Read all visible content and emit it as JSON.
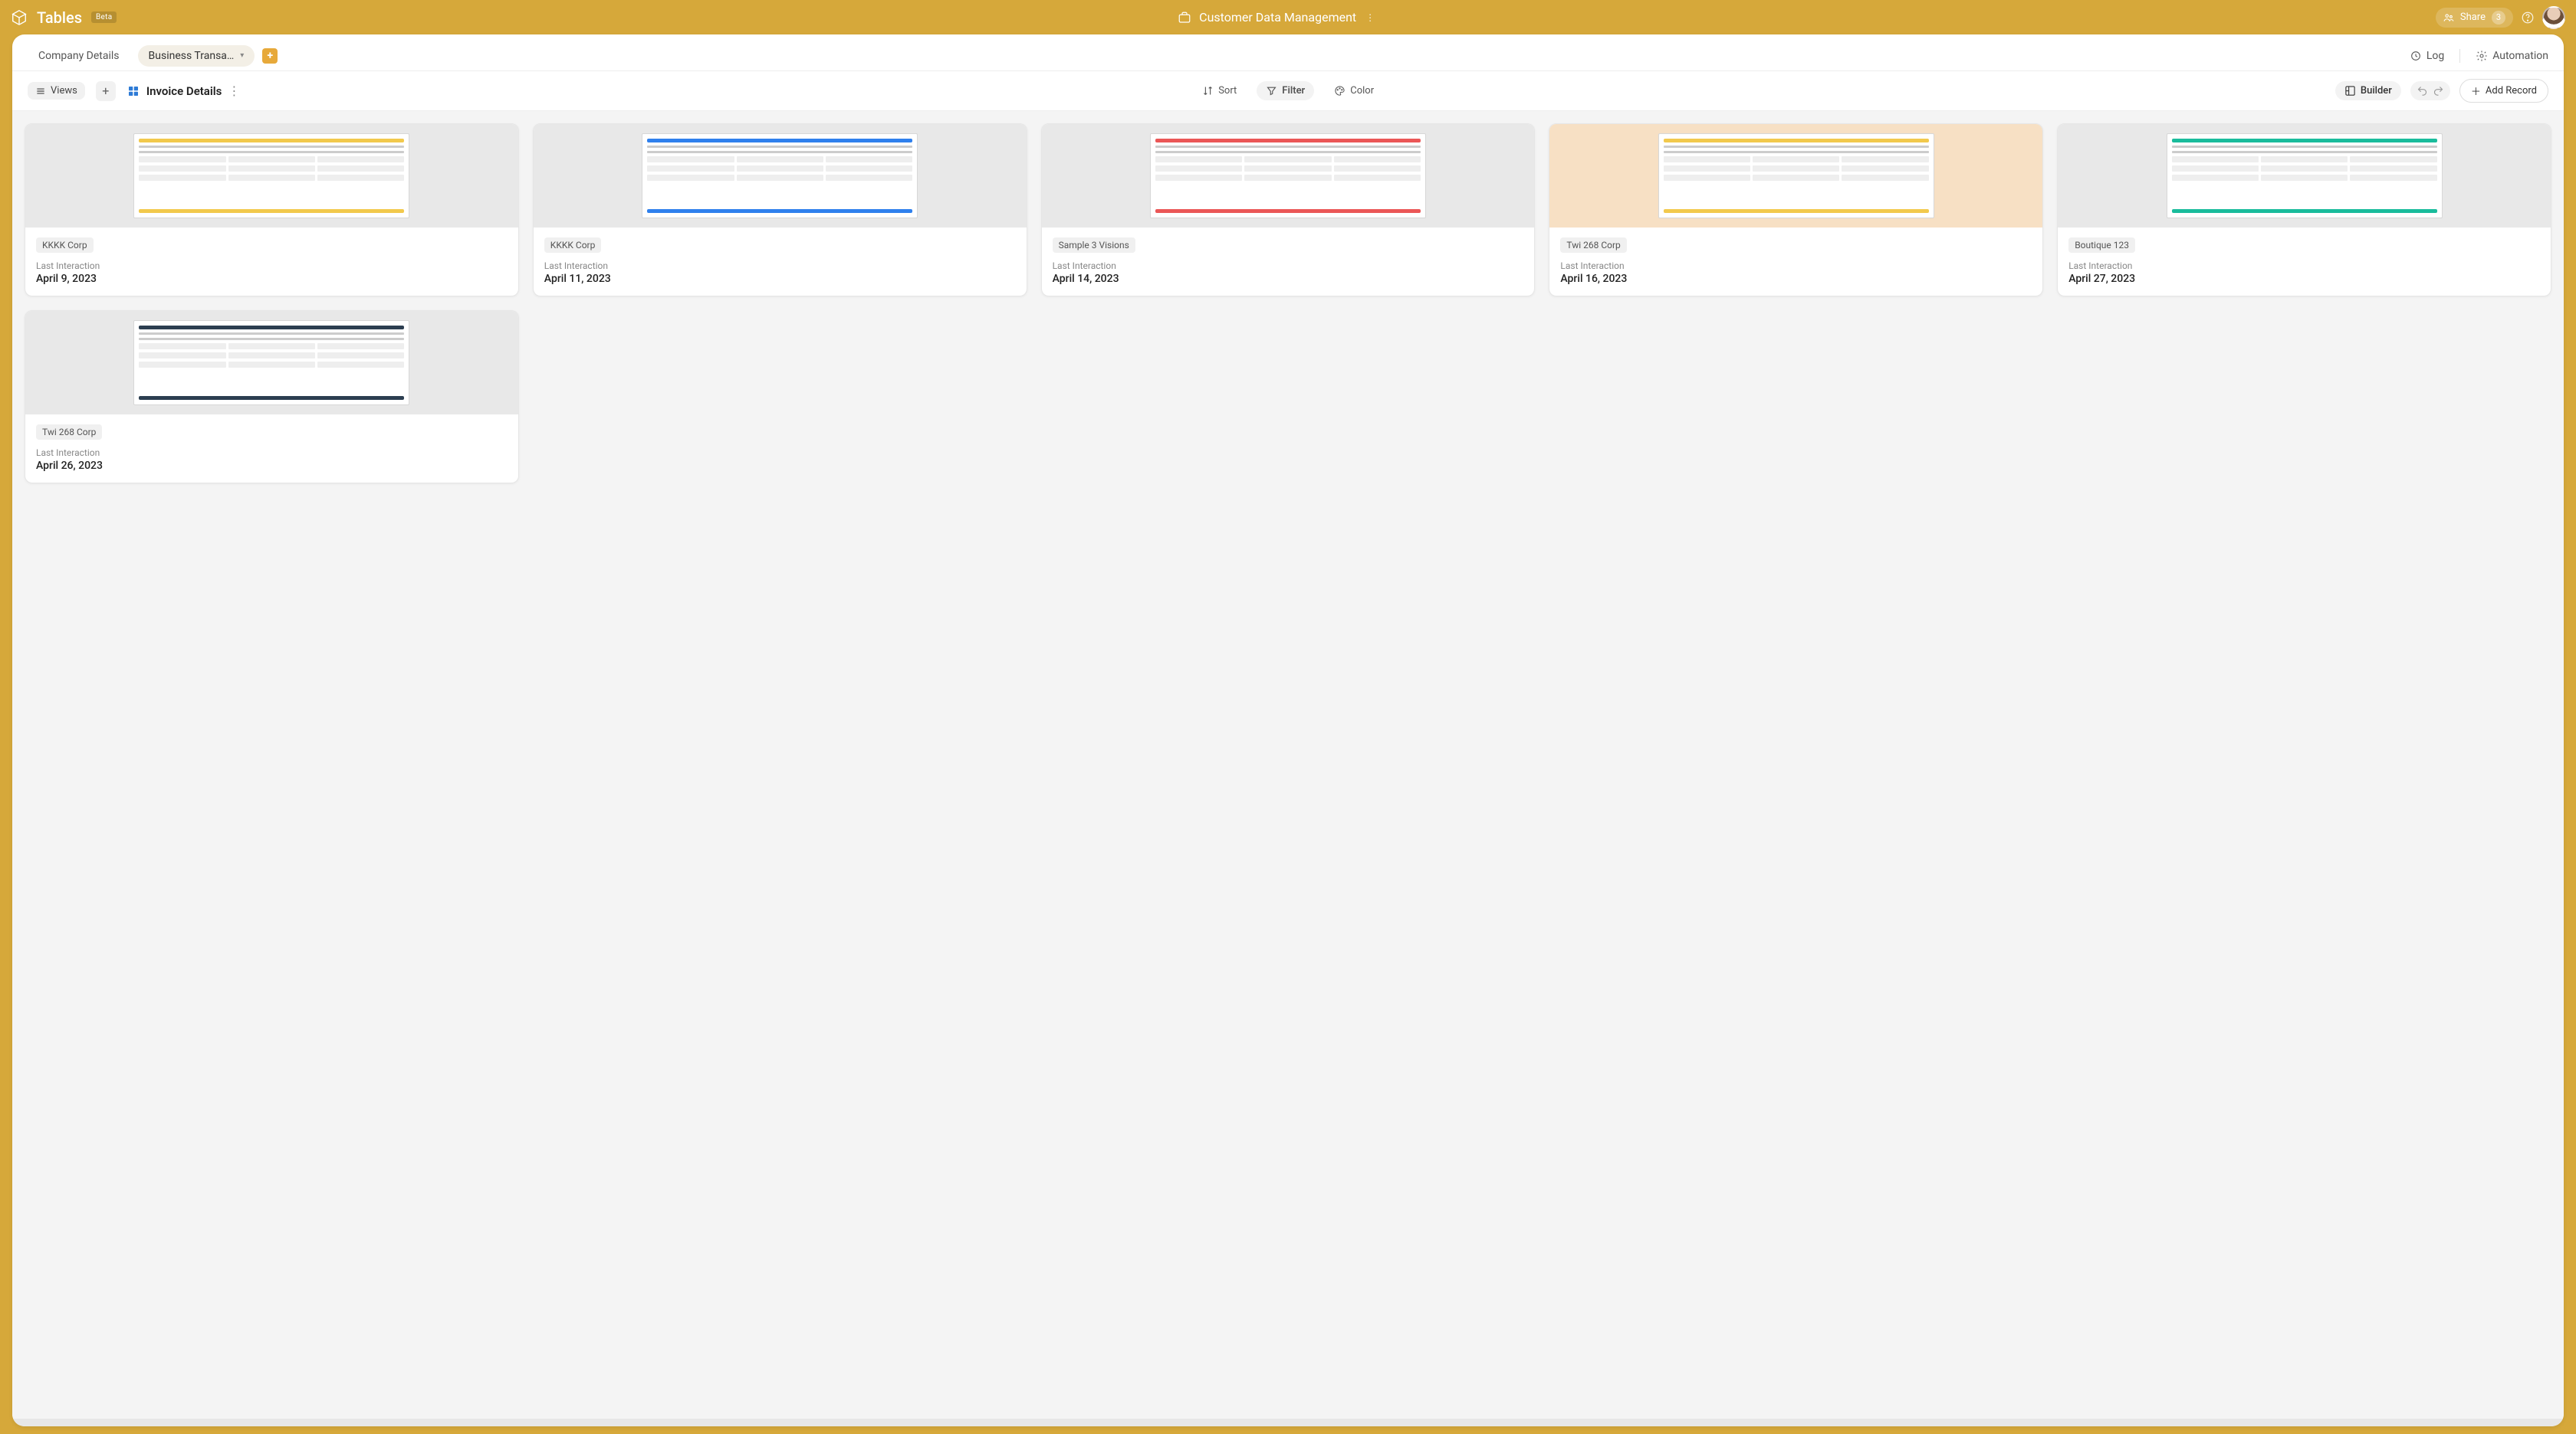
{
  "brand": {
    "app_name": "Tables",
    "badge": "Beta"
  },
  "header": {
    "workspace_name": "Customer Data Management",
    "share_label": "Share",
    "share_count": "3"
  },
  "tabs": {
    "inactive": "Company Details",
    "active": "Business Transa…",
    "log": "Log",
    "automation": "Automation"
  },
  "view": {
    "views_label": "Views",
    "name": "Invoice Details"
  },
  "tools": {
    "sort": "Sort",
    "filter": "Filter",
    "color": "Color",
    "builder": "Builder",
    "add_record": "Add Record"
  },
  "field_label": "Last Interaction",
  "records": [
    {
      "tag": "KKKK Corp",
      "date": "April 9, 2023",
      "accent": "c-yellow"
    },
    {
      "tag": "KKKK Corp",
      "date": "April 11, 2023",
      "accent": "c-blue"
    },
    {
      "tag": "Sample 3 Visions",
      "date": "April 14, 2023",
      "accent": "c-orange"
    },
    {
      "tag": "Twi 268 Corp",
      "date": "April 16, 2023",
      "accent": "c-yellow",
      "wrap": "c-peach"
    },
    {
      "tag": "Boutique 123",
      "date": "April 27, 2023",
      "accent": "c-teal"
    },
    {
      "tag": "Twi 268 Corp",
      "date": "April 26, 2023",
      "accent": "c-navy"
    }
  ]
}
